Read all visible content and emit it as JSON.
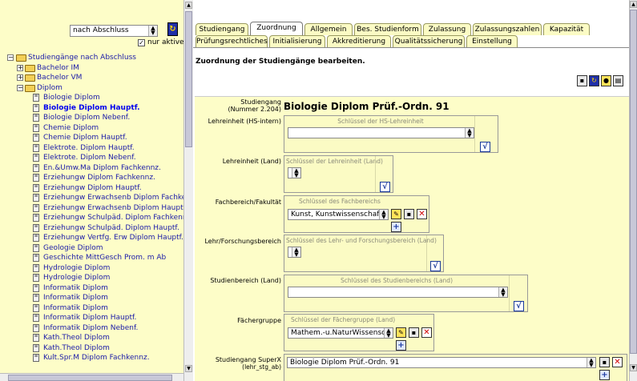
{
  "filter": {
    "selected": "nach Abschluss",
    "only_active_label": "nur aktive",
    "only_active_checked": true
  },
  "tree": {
    "root": "Studiengänge nach Abschluss",
    "groups": [
      "Bachelor IM",
      "Bachelor VM",
      "Diplom"
    ],
    "items": [
      "Biologie Diplom",
      "Biologie Diplom Hauptf.",
      "Biologie Diplom Nebenf.",
      "Chemie Diplom",
      "Chemie Diplom Hauptf.",
      "Elektrote. Diplom Hauptf.",
      "Elektrote. Diplom Nebenf.",
      "En.&Umw.Ma Diplom Fachkennz.",
      "Erziehungw Diplom Fachkennz.",
      "Erziehungw Diplom Hauptf.",
      "Erziehungw Erwachsenb Diplom Fachkennz",
      "Erziehungw Erwachsenb Diplom Hauptf.",
      "Erziehungw Schulpäd. Diplom Fachkennz.",
      "Erziehungw Schulpäd. Diplom Hauptf.",
      "Erziehungw Vertfg. Erw Diplom Hauptf.",
      "Geologie Diplom",
      "Geschichte MittGesch Prom. m Ab",
      "Hydrologie Diplom",
      "Hydrologie Diplom",
      "Informatik Diplom",
      "Informatik Diplom",
      "Informatik Diplom",
      "Informatik Diplom Hauptf.",
      "Informatik Diplom Nebenf.",
      "Kath.Theol Diplom",
      "Kath.Theol Diplom",
      "Kult.Spr.M Diplom Fachkennz."
    ]
  },
  "tabs_row1": [
    "Studiengang",
    "Zuordnung",
    "Allgemein",
    "Bes. Studienform",
    "Zulassung",
    "Zulassungszahlen",
    "Kapazität"
  ],
  "tabs_row2": [
    "Prüfungsrechtliches",
    "Initialisierung",
    "Akkreditierung",
    "Qualitätssicherung",
    "Einstellung"
  ],
  "heading": "Zuordnung der Studiengänge bearbeiten.",
  "record": {
    "label": "Studiengang",
    "number": "(Nummer 2.204)",
    "name": "Biologie Diplom Prüf.-Ordn. 91"
  },
  "fields": {
    "lehreinheit_hs": {
      "label": "Lehreinheit (HS-intern)",
      "caption": "Schlüssel der HS-Lehreinheit",
      "value": ""
    },
    "lehreinheit_land": {
      "label": "Lehreinheit (Land)",
      "caption": "Schlüssel der Lehreinheit (Land)",
      "value": ""
    },
    "fachbereich": {
      "label": "Fachbereich/Fakultät",
      "caption": "Schlüssel des Fachbereichs",
      "value": "Kunst, Kunstwissenschafte"
    },
    "lehr_forschung": {
      "label": "Lehr/Forschungsbereich",
      "caption": "Schlüssel des Lehr- und Forschungsbereich (Land)",
      "value": ""
    },
    "studienbereich": {
      "label": "Studienbereich (Land)",
      "caption": "Schlüssel des Studienbereichs (Land)",
      "value": ""
    },
    "faechergruppe": {
      "label": "Fächergruppe",
      "caption": "Schlüssel der Fächergruppe (Land)",
      "value": "Mathem.-u.NaturWissensch."
    },
    "superx": {
      "label": "Studiengang SuperX",
      "sublabel": "(lehr_stg_ab)",
      "value": "Biologie Diplom Prüf.-Ordn. 91"
    }
  },
  "colors": {
    "left_bg": "#fdfdc8",
    "tab_bg": "#fbfbc4",
    "link": "#1a1aa8"
  }
}
